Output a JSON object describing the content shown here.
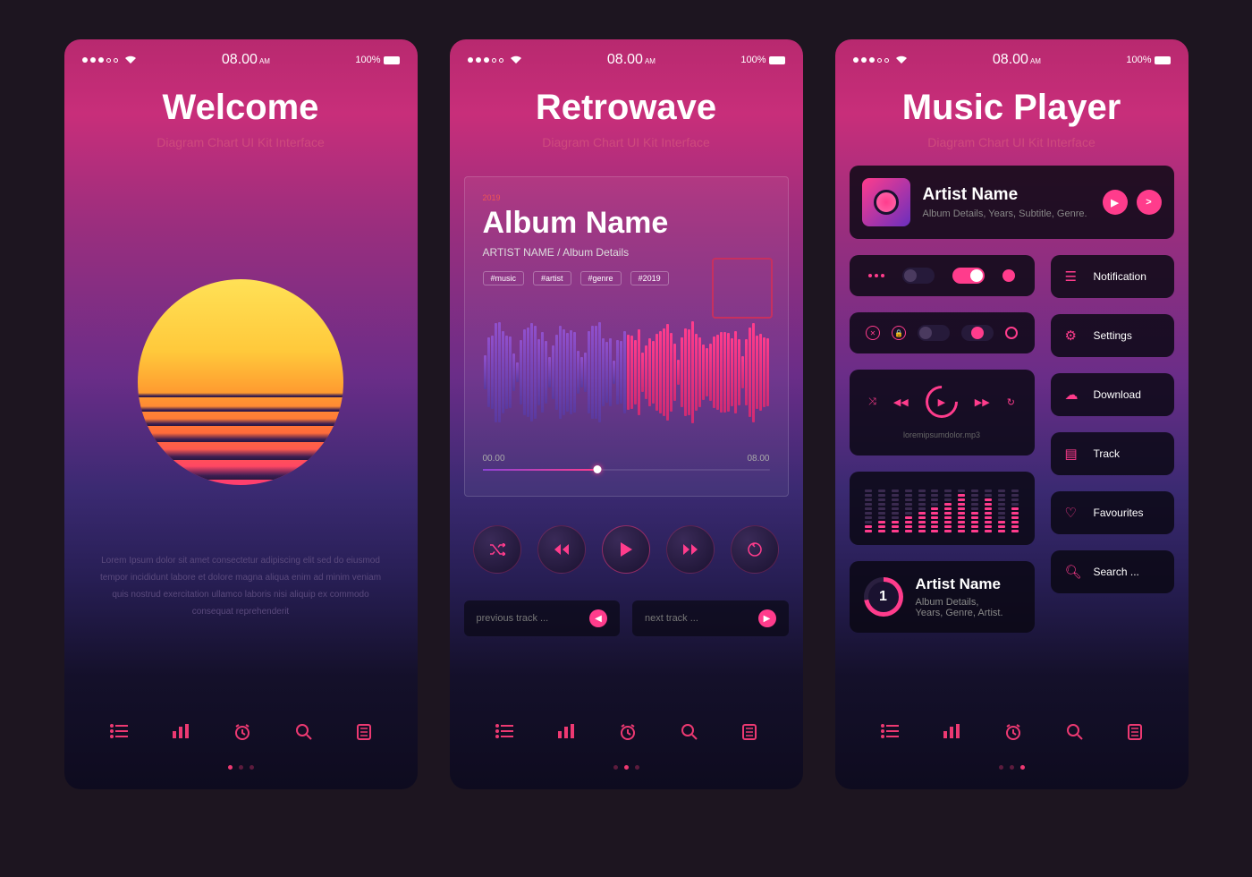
{
  "status": {
    "time": "08.00",
    "meridiem": "AM",
    "battery": "100%"
  },
  "screen1": {
    "title": "Welcome",
    "subtitle": "Diagram Chart UI Kit Interface",
    "lorem": "Lorem Ipsum dolor sit amet consectetur adipiscing elit sed do eiusmod tempor incididunt labore et dolore magna aliqua enim ad minim veniam quis nostrud exercitation ullamco laboris nisi aliquip ex commodo consequat reprehenderit"
  },
  "screen2": {
    "title": "Retrowave",
    "subtitle": "Diagram Chart UI Kit Interface",
    "year": "2019",
    "album": "Album Name",
    "albumSub": "ARTIST NAME / Album Details",
    "tags": [
      "#music",
      "#artist",
      "#genre",
      "#2019"
    ],
    "time_start": "00.00",
    "time_end": "08.00",
    "prev": "previous track ...",
    "next": "next track ..."
  },
  "screen3": {
    "title": "Music Player",
    "subtitle": "Diagram Chart UI Kit Interface",
    "artist1": {
      "name": "Artist Name",
      "sub": "Album Details, Years, Subtitle, Genre."
    },
    "file": "loremipsumdolor.mp3",
    "artist2": {
      "rank": "1",
      "name": "Artist Name",
      "sub1": "Album Details,",
      "sub2": "Years, Genre, Artist."
    },
    "menu": {
      "notification": "Notification",
      "settings": "Settings",
      "download": "Download",
      "track": "Track",
      "favourites": "Favourites",
      "search": "Search ..."
    }
  }
}
